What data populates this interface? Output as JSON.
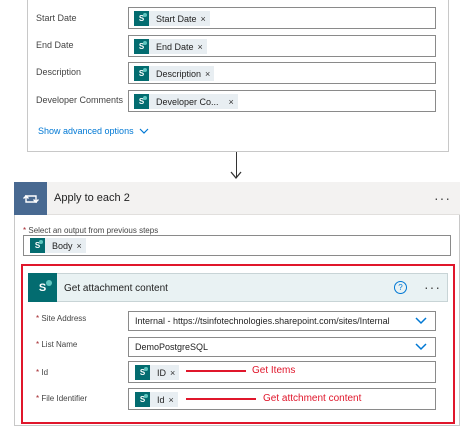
{
  "top_card": {
    "fields": [
      {
        "label": "Start Date",
        "token": "Start Date"
      },
      {
        "label": "End Date",
        "token": "End Date"
      },
      {
        "label": "Description",
        "token": "Description"
      },
      {
        "label": "Developer Comments",
        "token": "Developer Co..."
      }
    ],
    "advanced_link": "Show advanced options",
    "token_close": "×"
  },
  "apply_each": {
    "title": "Apply to each 2",
    "menu": "···",
    "select_label": "Select an output from previous steps",
    "select_token": "Body",
    "required_mark": "*"
  },
  "get_attachment": {
    "title": "Get attachment content",
    "help": "?",
    "menu": "···",
    "site_address_label": "Site Address",
    "site_address_value": "Internal - https://tsinfotechnologies.sharepoint.com/sites/Internal",
    "list_name_label": "List Name",
    "list_name_value": "DemoPostgreSQL",
    "id_label": "Id",
    "id_token": "ID",
    "file_identifier_label": "File Identifier",
    "file_identifier_token": "Id"
  },
  "annotations": {
    "get_items": "Get Items",
    "get_attachment": "Get attchment content"
  },
  "colors": {
    "sharepoint": "#036c70",
    "apply_each": "#486991",
    "highlight": "#e0162b",
    "link": "#0078d4"
  }
}
